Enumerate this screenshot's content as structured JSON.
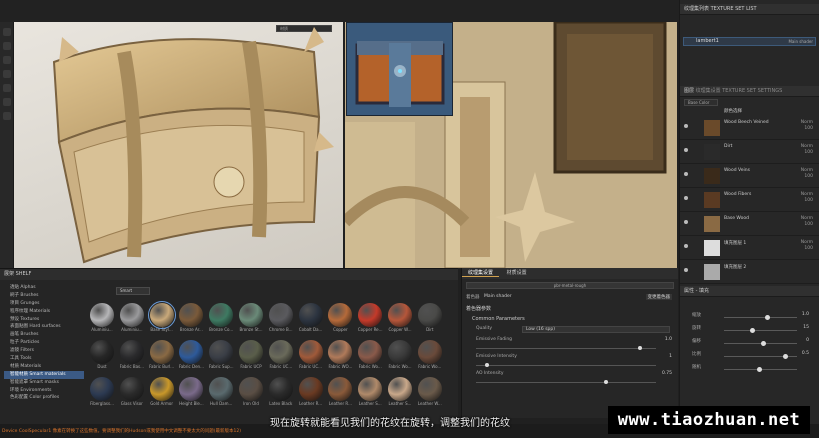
{
  "texture_set_list": {
    "title": "TEXTURE SET LIST",
    "prefix": "纹理集列表",
    "current": "lambert1",
    "shader": "Main shader"
  },
  "layers_panel": {
    "tab_layers": "图层",
    "tab_settings": "纹理集设置 TEXTURE SET SETTINGS",
    "channel": "Base Color",
    "group_label": "颜色选择",
    "layers": [
      {
        "name": "Wood Beech Veined",
        "blend": "Norm",
        "opacity": "100"
      },
      {
        "name": "Dirt",
        "blend": "Norm",
        "opacity": "100"
      },
      {
        "name": "Wood Veins",
        "blend": "Norm",
        "opacity": "100"
      },
      {
        "name": "Wood Fibers",
        "blend": "Norm",
        "opacity": "100"
      },
      {
        "name": "Base Wood",
        "blend": "Norm",
        "opacity": "100"
      },
      {
        "name": "填充图层 1",
        "blend": "Norm",
        "opacity": "100"
      },
      {
        "name": "填充图层 2",
        "blend": "",
        "opacity": ""
      }
    ]
  },
  "properties": {
    "title": "属性 - 填充",
    "rows": [
      {
        "label": "缩放",
        "value": "1.0",
        "pos": 0.55
      },
      {
        "label": "旋转",
        "value": "15",
        "pos": 0.35
      },
      {
        "label": "偏移",
        "value": "0",
        "pos": 0.5
      },
      {
        "label": "比例",
        "value": "0.5",
        "pos": 0.8
      },
      {
        "label": "随机",
        "value": "",
        "pos": 0.45
      }
    ]
  },
  "shelf": {
    "title": "展架 SHELF",
    "search_placeholder": "Smart",
    "categories": [
      "透贴 Alphas",
      "刷子 Brushes",
      "项目 Grunges",
      "程序纹理 Materials",
      "预设 Textures",
      "表面贴图 Hard surfaces",
      "画笔 Brushes",
      "粒子 Particles",
      "滤镜 Filters",
      "工具 Tools",
      "材质 Materials",
      "智能材质 Smart materials",
      "智能遮罩 Smart masks",
      "环境 Environments",
      "色彩配置 Color profiles"
    ],
    "selected_category": 11,
    "materials": [
      {
        "name": "Aluminiu...",
        "color": "#b6b6b8"
      },
      {
        "name": "Aluminiu...",
        "color": "#9a9a9c"
      },
      {
        "name": "Base Styl...",
        "color": "#c9a97a"
      },
      {
        "name": "Bronze Ar...",
        "color": "#7a5a3a"
      },
      {
        "name": "Bronze Co...",
        "color": "#3e7a62"
      },
      {
        "name": "Bronze St...",
        "color": "#6a8a78"
      },
      {
        "name": "Chrome B...",
        "color": "#5a5a5e"
      },
      {
        "name": "Cobalt Da...",
        "color": "#2c3440"
      },
      {
        "name": "Copper",
        "color": "#b56a3a"
      },
      {
        "name": "Copper Re...",
        "color": "#c43a2a"
      },
      {
        "name": "Copper W...",
        "color": "#b5563a"
      },
      {
        "name": "Dirt",
        "color": "#4a4a48"
      },
      {
        "name": "Dust",
        "color": "#262626"
      },
      {
        "name": "Fabric Bas...",
        "color": "#2a2a2c"
      },
      {
        "name": "Fabric Burl...",
        "color": "#8a6a44"
      },
      {
        "name": "Fabric Den...",
        "color": "#2e5a9a"
      },
      {
        "name": "Fabric Sup...",
        "color": "#3a3e46"
      },
      {
        "name": "Fabric UCP",
        "color": "#5a5e4a"
      },
      {
        "name": "Fabric UC...",
        "color": "#6a6a5a"
      },
      {
        "name": "Fabric UC...",
        "color": "#a05a3a"
      },
      {
        "name": "Fabric WO...",
        "color": "#b07a5a"
      },
      {
        "name": "Fabric Wo...",
        "color": "#8a5a4a"
      },
      {
        "name": "Fabric Wo...",
        "color": "#3a3a3a"
      },
      {
        "name": "Fabric Wo...",
        "color": "#6a4a3a"
      },
      {
        "name": "Fiberglass...",
        "color": "#2c3a52"
      },
      {
        "name": "Glass Visor",
        "color": "#2a2a2a"
      },
      {
        "name": "Gold Armor",
        "color": "#c9982a"
      },
      {
        "name": "Height Ble...",
        "color": "#7a6a8a"
      },
      {
        "name": "Hull Dam...",
        "color": "#5a6a6e"
      },
      {
        "name": "Iron Old",
        "color": "#5a4e44"
      },
      {
        "name": "Latex Black",
        "color": "#2a2a2a"
      },
      {
        "name": "Leather R...",
        "color": "#6a3a22"
      },
      {
        "name": "Leather R...",
        "color": "#8a5a3a"
      },
      {
        "name": "Leather S...",
        "color": "#b08a6a"
      },
      {
        "name": "Leather S...",
        "color": "#c9a88a"
      },
      {
        "name": "Leather W...",
        "color": "#6a5a4a"
      }
    ],
    "selected_material": 2
  },
  "texture_set_settings": {
    "tab_a": "纹理集设置",
    "tab_b": "材质设置",
    "shader_label": "着色器",
    "shader_value": "Main shader",
    "shader_btn": "pbr-metal-rough",
    "edit_btn": "变更着色器",
    "section": "着色器参数",
    "subsection": "Common Parameters",
    "rows": [
      {
        "label": "Quality",
        "value": "Low (16 spp)"
      },
      {
        "label": "Emissive Fading",
        "value": "1.0",
        "pos": 0.95
      },
      {
        "label": "Emissive Intensity",
        "value": "1",
        "pos": 0.05
      },
      {
        "label": "AO Intensity",
        "value": "0.75",
        "pos": 0.75
      }
    ]
  },
  "viewport": {
    "mode_left": "材质",
    "mode_right": "材质"
  },
  "status_text": "Device CoolSpecular1 像素在转换了这些数值。要调整我们的Hudson或我使用中文调整不要太大的问题(最新版本12)",
  "subtitle": "现在旋转就能看见我们的花纹在旋转，调整我们的花纹",
  "watermark": "www.tiaozhuan.net"
}
